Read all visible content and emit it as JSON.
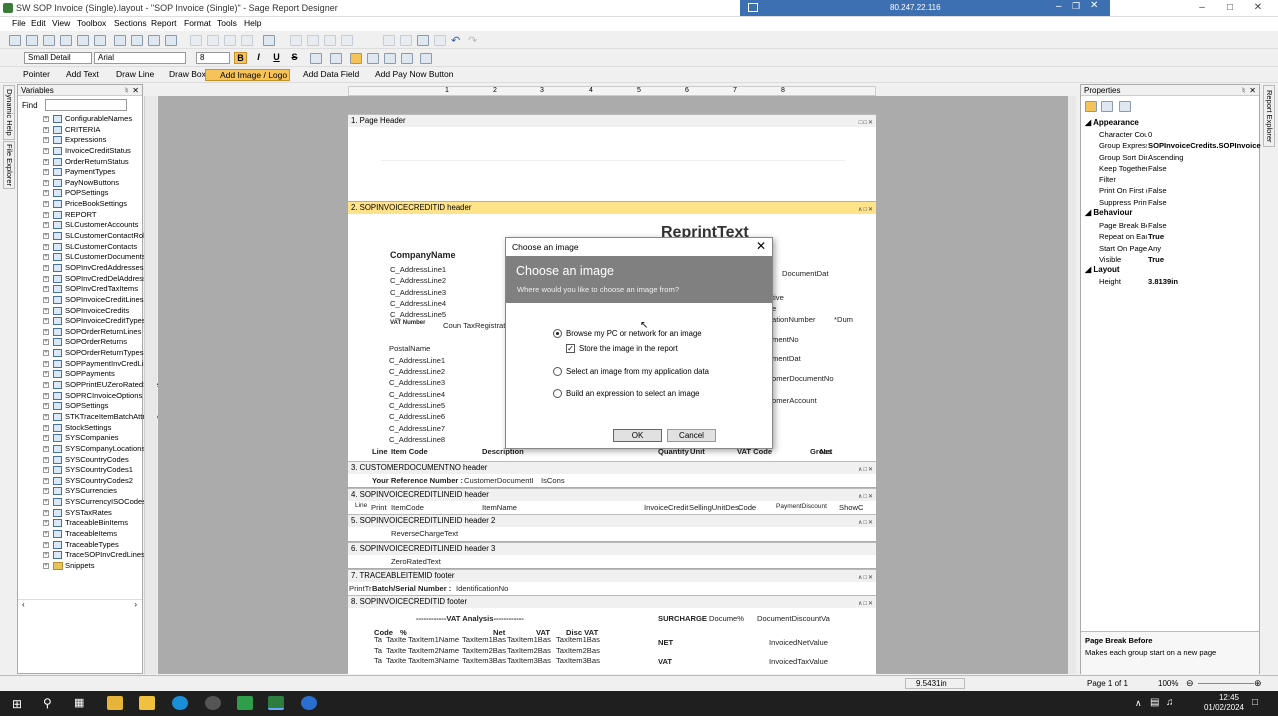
{
  "window": {
    "title": "SW SOP Invoice (Single).layout - \"SOP Invoice (Single)\" - Sage Report Designer",
    "remote_ip": "80.247.22.116"
  },
  "menu": [
    "File",
    "Edit",
    "View",
    "Toolbox",
    "Sections",
    "Report",
    "Format",
    "Tools",
    "Help"
  ],
  "format": {
    "style": "Small Detail",
    "font": "Arial",
    "size": "8"
  },
  "tools": {
    "pointer": "Pointer",
    "add_text": "Add Text",
    "draw_line": "Draw Line",
    "draw_box": "Draw Box",
    "add_image": "Add Image / Logo",
    "add_data_field": "Add Data Field",
    "add_pay_now": "Add Pay Now Button"
  },
  "variables": {
    "title": "Variables",
    "find_label": "Find",
    "items": [
      "ConfigurableNames",
      "CRITERIA",
      "Expressions",
      "InvoiceCreditStatus",
      "OrderReturnStatus",
      "PaymentTypes",
      "PayNowButtons",
      "POPSettings",
      "PriceBookSettings",
      "REPORT",
      "SLCustomerAccounts",
      "SLCustomerContactRoles",
      "SLCustomerContacts",
      "SLCustomerDocuments",
      "SOPInvCredAddresses",
      "SOPInvCredDelAddresses",
      "SOPInvCredTaxItems",
      "SOPInvoiceCreditLines",
      "SOPInvoiceCredits",
      "SOPInvoiceCreditTypes",
      "SOPOrderReturnLines",
      "SOPOrderReturns",
      "SOPOrderReturnTypes",
      "SOPPaymentInvCredLines",
      "SOPPayments",
      "SOPPrintEUZeroRatedSalesO",
      "SOPRCInvoiceOptions",
      "SOPSettings",
      "STKTraceItemBatchAttribute",
      "StockSettings",
      "SYSCompanies",
      "SYSCompanyLocations",
      "SYSCountryCodes",
      "SYSCountryCodes1",
      "SYSCountryCodes2",
      "SYSCurrencies",
      "SYSCurrencyISOCodes",
      "SYSTaxRates",
      "TraceableBinItems",
      "TraceableItems",
      "TraceableTypes",
      "TraceSOPInvCredLines"
    ],
    "folder": "Snippets"
  },
  "sidetabs": {
    "left1": "Dynamic Help",
    "left2": "File Explorer",
    "right": "Report Explorer"
  },
  "ruler": [
    "1",
    "2",
    "3",
    "4",
    "5",
    "6",
    "7",
    "8"
  ],
  "sections": {
    "s1": "1. Page Header",
    "s2": "2. SOPINVOICECREDITID header",
    "s3": "3. CUSTOMERDOCUMENTNO header",
    "s4": "4. SOPINVOICECREDITLINEID header",
    "s5": "5. SOPINVOICECREDITLINEID header 2",
    "s6": "6. SOPINVOICECREDITLINEID header 3",
    "s7": "7. TRACEABLEITEMID footer",
    "s8": "8. SOPINVOICECREDITID footer"
  },
  "report": {
    "reprint": "ReprintText",
    "company": "CompanyName",
    "addr": [
      "C_AddressLine1",
      "C_AddressLine2",
      "C_AddressLine3",
      "C_AddressLine4",
      "C_AddressLine5"
    ],
    "vat_label": "VAT Number",
    "vat_value": "Coun TaxRegistrati",
    "postal": "PostalName",
    "paddr": [
      "C_AddressLine1",
      "C_AddressLine2",
      "C_AddressLine3",
      "C_AddressLine4",
      "C_AddressLine5",
      "C_AddressLine6",
      "C_AddressLine7",
      "C_AddressLine8"
    ],
    "right": [
      "DocumentDat",
      "tive",
      "e",
      "ationNumber",
      "*Dum",
      "mentNo",
      "mentDat",
      "omerDocumentNo",
      "omerAccount"
    ],
    "line_headers": [
      "Line",
      "Item Code",
      "Description",
      "Quantity",
      "Unit",
      "VAT Code",
      "Gross",
      "Net"
    ],
    "your_ref_label": "Your Reference Number :",
    "your_ref_value": "CustomerDocumentI",
    "iscons": "IsCons",
    "s4_fields": [
      "Line",
      "Print",
      "ItemCode",
      "ItemName",
      "InvoiceCredit",
      "SellingUnitDes",
      "Code",
      "PaymentDiscount",
      "ShowC"
    ],
    "reverse": "ReverseChargeText",
    "zero": "ZeroRatedText",
    "print_tr": "PrintTr",
    "batch_label": "Batch/Serial Number :",
    "batch_value": "IdentificationNo",
    "vat_analysis": "------------VAT Analysis------------",
    "vat_cols": [
      "Code",
      "%",
      "Net",
      "VAT",
      "Disc VAT"
    ],
    "vat_rows": [
      [
        "Ta",
        "TaxIte",
        "TaxItem1Name",
        "TaxItem1Bas",
        "TaxItem1Bas",
        "TaxItem1Bas"
      ],
      [
        "Ta",
        "TaxIte",
        "TaxItem2Name",
        "TaxItem2Bas",
        "TaxItem2Bas",
        "TaxItem2Bas"
      ],
      [
        "Ta",
        "TaxIte",
        "TaxItem3Name",
        "TaxItem3Bas",
        "TaxItem3Bas",
        "TaxItem3Bas"
      ]
    ],
    "surcharge": "SURCHARGE",
    "docume": "Docume%",
    "doc_disc": "DocumentDiscountVa",
    "net_label": "NET",
    "net_value": "InvoicedNetValue",
    "vat_label2": "VAT",
    "vat_value2": "InvoicedTaxValue"
  },
  "dialog": {
    "title": "Choose an image",
    "heading": "Choose an image",
    "subtitle": "Where would you like to choose an image from?",
    "opt1": "Browse my PC or network for an image",
    "store": "Store the image in the report",
    "opt2": "Select an image from my application data",
    "opt3": "Build an expression to select an image",
    "ok": "OK",
    "cancel": "Cancel"
  },
  "properties": {
    "title": "Properties",
    "appearance": "Appearance",
    "app_rows": [
      [
        "Character Cou",
        "0"
      ],
      [
        "Group Express",
        "SOPInvoiceCredits.SOPInvoice"
      ],
      [
        "Group Sort Dir",
        "Ascending"
      ],
      [
        "Keep Together",
        "False"
      ],
      [
        "Filter",
        ""
      ],
      [
        "Print On First (",
        "False"
      ],
      [
        "Suppress Print",
        "False"
      ]
    ],
    "behaviour": "Behaviour",
    "beh_rows": [
      [
        "Page Break Be",
        "False"
      ],
      [
        "Repeat on Eac",
        "True"
      ],
      [
        "Start On Page",
        "Any"
      ],
      [
        "Visible",
        "True"
      ]
    ],
    "layout": "Layout",
    "lay_rows": [
      [
        "Height",
        "3.8139in"
      ]
    ],
    "help_title": "Page Break Before",
    "help_text": "Makes each group start on a new page"
  },
  "status": {
    "position": "9.5431in",
    "page": "Page 1 of 1",
    "zoom": "100%"
  },
  "clock": {
    "time": "12:45",
    "date": "01/02/2024"
  }
}
